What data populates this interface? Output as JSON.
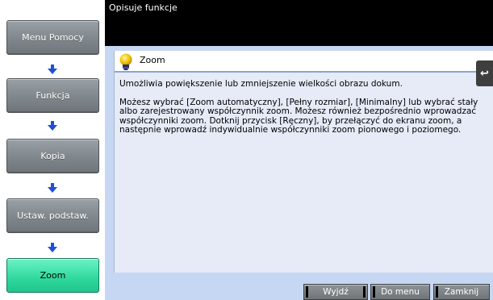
{
  "header": {
    "text": "Opisuje funkcje"
  },
  "nav": {
    "items": [
      {
        "label": "Menu Pomocy",
        "active": false
      },
      {
        "label": "Funkcja",
        "active": false
      },
      {
        "label": "Kopia",
        "active": false
      },
      {
        "label": "Ustaw. podstaw.",
        "active": false
      },
      {
        "label": "Zoom",
        "active": true
      }
    ],
    "arrow_icon": "down-arrow-icon"
  },
  "panel": {
    "title": "Zoom",
    "title_icon": "lightbulb-icon",
    "paragraphs": [
      "Umożliwia powiększenie lub zmniejszenie wielkości obrazu dokum.",
      "Możesz wybrać [Zoom automatyczny], [Pełny rozmiar], [Minimalny] lub wybrać stały albo zarejestrowany współczynnik zoom. Możesz również bezpośrednio wprowadzać współczynniki zoom. Dotknij przycisk [Ręczny], by przełączyć do ekranu zoom, a następnie wprowadź indywidualnie współczynniki zoom pionowego i poziomego."
    ]
  },
  "back_tab": {
    "icon": "back-arrow-icon",
    "glyph": "↩"
  },
  "footer": {
    "exit_label": "Wyjdź",
    "menu_label": "Do menu",
    "close_label": "Zamknij"
  },
  "colors": {
    "active_nav": "#2fd89e",
    "nav_button": "#80878c",
    "panel_bg": "#e6ebf7",
    "frame_bg": "#c6d7f3",
    "header_bg": "#000000"
  }
}
